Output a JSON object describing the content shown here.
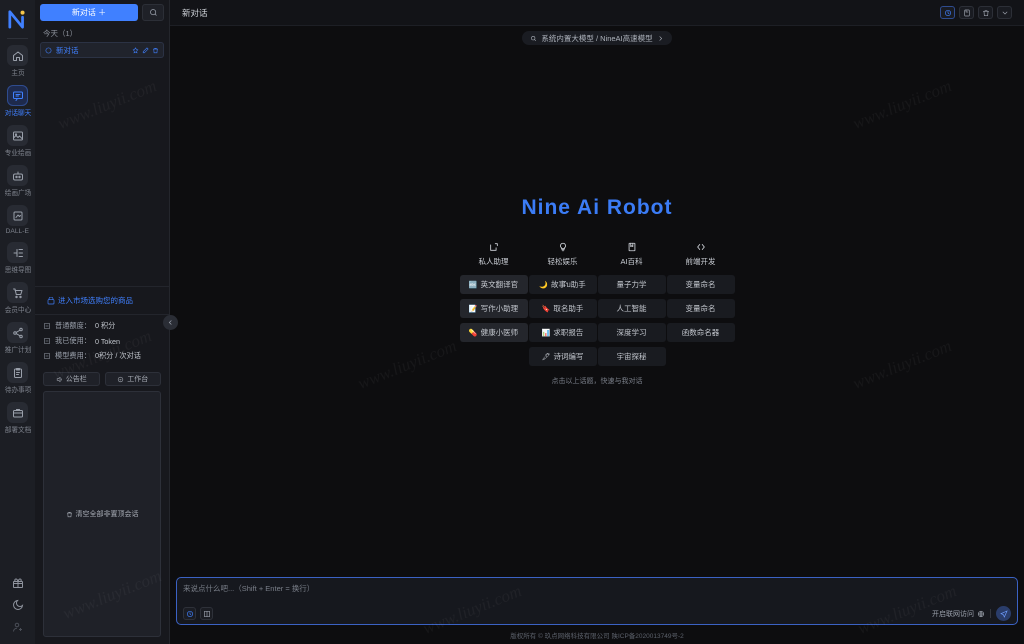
{
  "brand": {
    "logo_name": "nineai-logo",
    "accent": "#4080ff",
    "title_color": "#3b7cf6"
  },
  "watermark": {
    "text": "www.liuyii.com"
  },
  "rail": {
    "items": [
      {
        "label": "主页",
        "icon": "home-icon",
        "active": false
      },
      {
        "label": "对话聊天",
        "icon": "chat-icon",
        "active": true
      },
      {
        "label": "专业绘画",
        "icon": "image-icon",
        "active": false
      },
      {
        "label": "绘画广场",
        "icon": "gallery-icon",
        "active": false
      },
      {
        "label": "DALL-E",
        "icon": "dalle-icon",
        "active": false
      },
      {
        "label": "思维导图",
        "icon": "mindmap-icon",
        "active": false
      },
      {
        "label": "会员中心",
        "icon": "cart-icon",
        "active": false
      },
      {
        "label": "推广计划",
        "icon": "share-icon",
        "active": false
      },
      {
        "label": "待办事项",
        "icon": "clipboard-icon",
        "active": false
      },
      {
        "label": "部署文档",
        "icon": "briefcase-icon",
        "active": false
      }
    ],
    "bottom": [
      {
        "icon": "gift-icon",
        "name": "gift-button"
      },
      {
        "icon": "moon-icon",
        "name": "theme-toggle-button"
      },
      {
        "icon": "user-add-icon",
        "name": "account-button"
      }
    ]
  },
  "sidebar": {
    "new_chat_label": "新对话 ＋",
    "search_icon": "search-icon",
    "group_label": "今天（1）",
    "conversations": [
      {
        "title": "新对话",
        "icon": "chat-bubble-icon",
        "actions": [
          "pin-icon",
          "edit-icon",
          "delete-icon"
        ]
      }
    ],
    "market_link": "进入市场选购您的商品",
    "stats": [
      {
        "icon": "quota-icon",
        "label": "普通额度：",
        "value": "0 积分"
      },
      {
        "icon": "token-icon",
        "label": "我已使用：",
        "value": "0 Token"
      },
      {
        "icon": "cost-icon",
        "label": "模型费用：",
        "value": "0积分 / 次对话"
      }
    ],
    "buttons": [
      {
        "label": "公告栏",
        "icon": "announcement-icon"
      },
      {
        "label": "工作台",
        "icon": "workbench-icon"
      }
    ],
    "clear_button": {
      "label": "清空全部非置顶会话",
      "icon": "trash-icon"
    },
    "collapse_icon": "chevron-left-icon"
  },
  "topbar": {
    "title": "新对话",
    "actions": [
      {
        "name": "history-button",
        "icon": "clock-icon",
        "active": true
      },
      {
        "name": "save-button",
        "icon": "save-icon",
        "active": false
      },
      {
        "name": "delete-button",
        "icon": "trash-icon",
        "active": false
      },
      {
        "name": "more-button",
        "icon": "chevron-down-icon",
        "active": false
      }
    ]
  },
  "model_selector": {
    "icon": "model-icon",
    "label": "系统内置大模型 / NineAI高速模型",
    "chevron": "chevron-right-icon"
  },
  "hero": {
    "title": "Nine Ai Robot",
    "categories": [
      {
        "label": "私人助理",
        "icon": "assistant-icon"
      },
      {
        "label": "轻松娱乐",
        "icon": "bulb-icon"
      },
      {
        "label": "AI百科",
        "icon": "book-icon"
      },
      {
        "label": "前端开发",
        "icon": "code-icon"
      }
    ],
    "columns": [
      [
        {
          "label": "英文翻译官",
          "emoji": "🔤",
          "highlight": true
        },
        {
          "label": "写作小助理",
          "emoji": "📝",
          "highlight": true
        },
        {
          "label": "健康小医师",
          "emoji": "💊",
          "highlight": true
        }
      ],
      [
        {
          "label": "故事ับ助手",
          "emoji": "🌙",
          "highlight": false
        },
        {
          "label": "取名助手",
          "emoji": "🔖",
          "highlight": false
        },
        {
          "label": "求职报告",
          "emoji": "📊",
          "highlight": false
        },
        {
          "label": "诗词编写",
          "emoji": "🖋",
          "highlight": false
        }
      ],
      [
        {
          "label": "量子力学",
          "emoji": "",
          "highlight": false
        },
        {
          "label": "人工智能",
          "emoji": "",
          "highlight": false
        },
        {
          "label": "深度学习",
          "emoji": "",
          "highlight": false
        },
        {
          "label": "宇宙探秘",
          "emoji": "",
          "highlight": false
        }
      ],
      [
        {
          "label": "变量命名",
          "emoji": "",
          "highlight": false
        },
        {
          "label": "变量命名",
          "emoji": "",
          "highlight": false
        },
        {
          "label": "函数命名器",
          "emoji": "",
          "highlight": false
        }
      ]
    ],
    "hint": "点击以上话题，快速与我对话"
  },
  "composer": {
    "placeholder": "来说点什么吧...（Shift + Enter = 换行）",
    "value": "",
    "left_icons": [
      {
        "name": "history-icon",
        "blue": true
      },
      {
        "name": "layout-icon",
        "blue": false
      }
    ],
    "net_label": "开启联网访问",
    "net_icon": "globe-icon",
    "send_icon": "send-icon"
  },
  "footer": {
    "text": "版权所有 © 玖点网络科技有限公司  陕ICP备2020013749号-2"
  }
}
